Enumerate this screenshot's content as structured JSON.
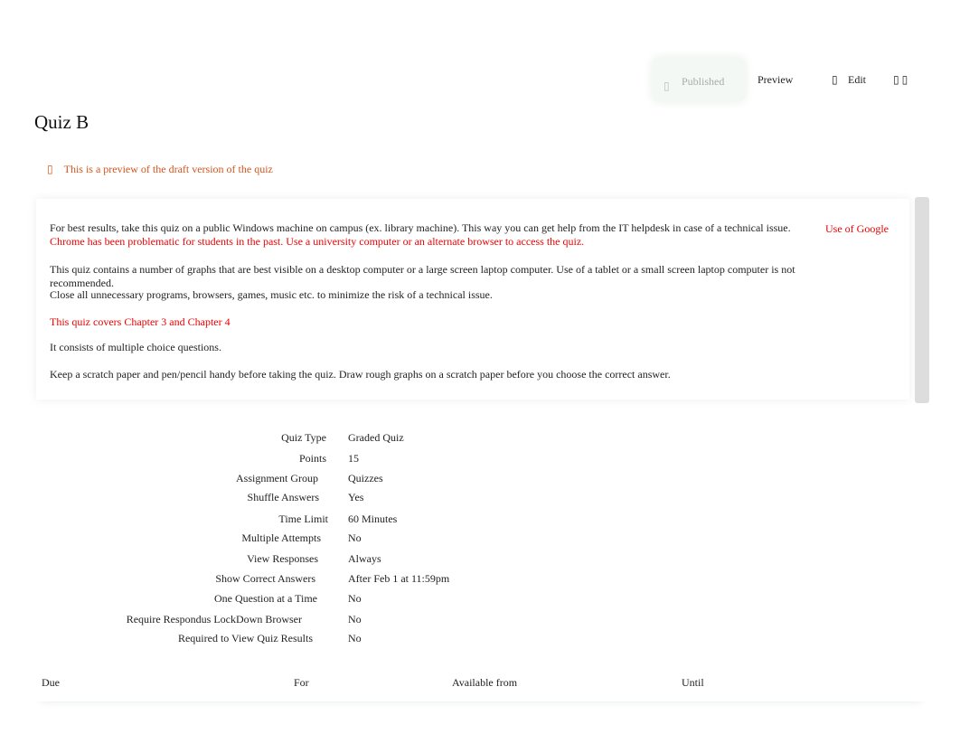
{
  "toolbar": {
    "published": "Published",
    "preview": "Preview",
    "edit": "Edit",
    "more_icon": "ellipsis-icon",
    "published_icon": "check-circle-icon",
    "edit_icon": "pencil-icon"
  },
  "title": "Quiz B",
  "warning": "This is a preview of the draft version of the quiz",
  "description": {
    "p1": "For best results, take this quiz on a public Windows machine on campus (ex. library machine). This way you can get help from the IT helpdesk in case of a technical issue.",
    "p1_link": "Use of Google",
    "p1_red": "Chrome has been problematic for students in the past. Use a university computer or an alternate browser to access the quiz.",
    "p2": "This quiz contains a number of graphs that are best visible on a desktop computer or a large screen laptop computer. Use of a tablet or a small screen laptop computer is not recommended.",
    "p3": "Close all unnecessary programs, browsers, games, music etc. to minimize the risk of a technical issue.",
    "p4": "This quiz covers Chapter 3 and Chapter 4",
    "p5": "It consists of multiple choice questions.",
    "p6": "Keep a scratch paper and pen/pencil handy before taking the quiz. Draw rough graphs on a scratch paper before you choose the correct answer."
  },
  "details": [
    {
      "label": "Quiz Type",
      "value": "Graded Quiz"
    },
    {
      "label": "Points",
      "value": "15"
    },
    {
      "label": "Assignment Group",
      "value": "Quizzes"
    },
    {
      "label": "Shuffle Answers",
      "value": "Yes"
    },
    {
      "label": "Time Limit",
      "value": "60 Minutes"
    },
    {
      "label": "Multiple Attempts",
      "value": "No"
    },
    {
      "label": "View Responses",
      "value": "Always"
    },
    {
      "label": "Show Correct Answers",
      "value": "After Feb 1 at 11:59pm"
    },
    {
      "label": "One Question at a Time",
      "value": "No"
    },
    {
      "label": "Require Respondus LockDown Browser",
      "value": "No"
    },
    {
      "label": "Required to View Quiz Results",
      "value": "No"
    }
  ],
  "table": {
    "headers": [
      "Due",
      "For",
      "Available from",
      "Until"
    ]
  }
}
